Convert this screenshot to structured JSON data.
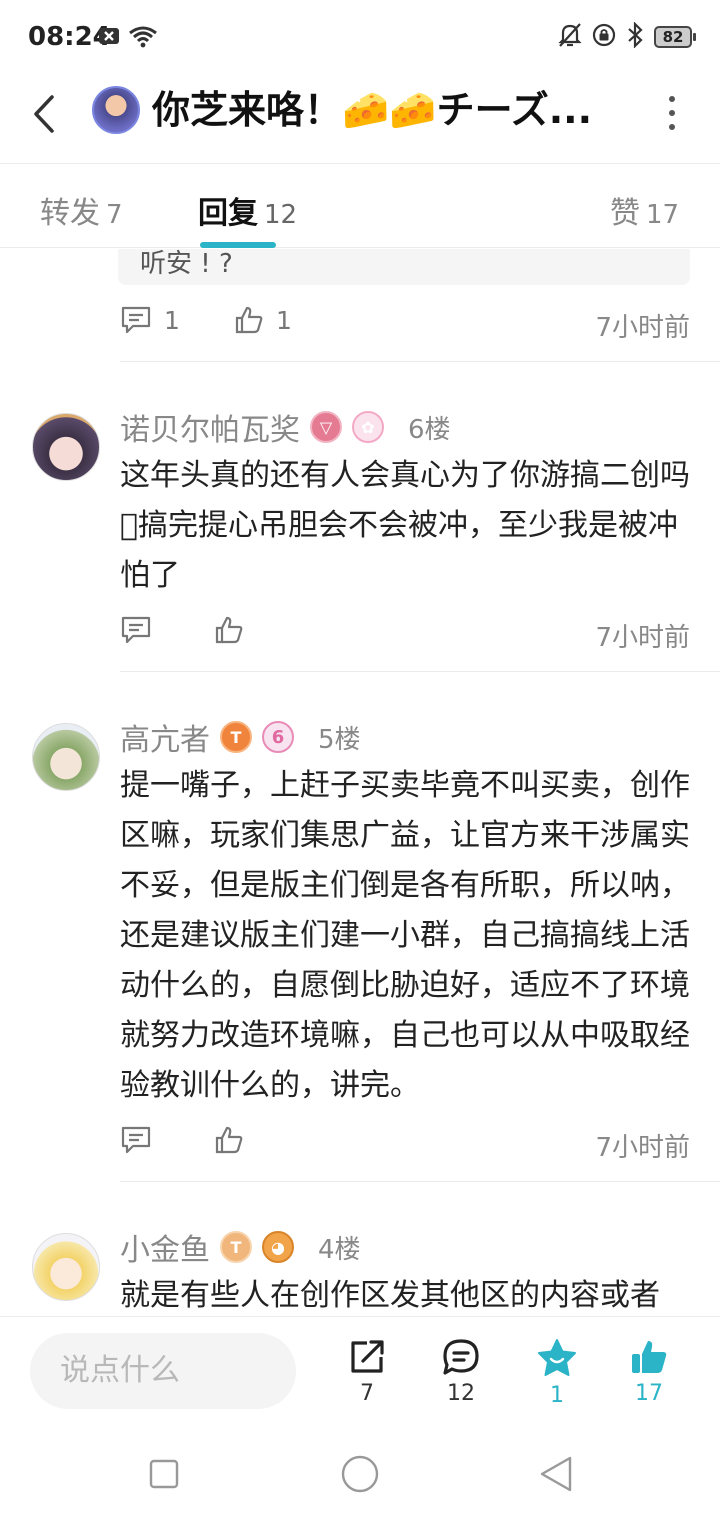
{
  "status_bar": {
    "time": "08:24",
    "battery": "82",
    "icons": [
      "close-box-icon",
      "wifi-icon",
      "mute-icon",
      "lock-icon",
      "bluetooth-icon",
      "battery-icon"
    ]
  },
  "header": {
    "title": "你芝来咯！🧀🧀チーズ...",
    "icons": [
      "back-icon",
      "more-icon"
    ]
  },
  "tabs": [
    {
      "label": "转发",
      "count": "7"
    },
    {
      "label": "回复",
      "count": "12",
      "active": true
    },
    {
      "label": "赞",
      "count": "17"
    }
  ],
  "prev_comment": {
    "quote_tail": "听安 ! ?",
    "reply_count": "1",
    "like_count": "1",
    "time": "7小时前"
  },
  "comments": [
    {
      "username": "诺贝尔帕瓦奖",
      "badges": [
        "pink-level-badge",
        "pink-character-badge"
      ],
      "floor": "6楼",
      "text": "这年头真的还有人会真心为了你游搞二创吗􏿾搞完提心吊胆会不会被冲，至少我是被冲怕了",
      "time": "7小时前"
    },
    {
      "username": "高亢者",
      "badges": [
        "orange-level-badge",
        "pink-cake-badge"
      ],
      "floor": "5楼",
      "text": "提一嘴子，上赶子买卖毕竟不叫买卖，创作区嘛，玩家们集思广益，让官方来干涉属实不妥，但是版主们倒是各有所职，所以呐，还是建议版主们建一小群，自己搞搞线上活动什么的，自愿倒比胁迫好，适应不了环境就努力改造环境嘛，自己也可以从中吸取经验教训什么的，讲完。",
      "time": "7小时前"
    },
    {
      "username": "小金鱼",
      "badges": [
        "peach-level-badge",
        "orange-cookie-badge"
      ],
      "floor": "4楼",
      "text": "就是有些人在创作区发其他区的内容或者",
      "time": ""
    }
  ],
  "bottom_bar": {
    "input_placeholder": "说点什么",
    "share_count": "7",
    "reply_count": "12",
    "fav_count": "1",
    "like_count": "17",
    "accent_color": "#2bb3c7"
  },
  "nav_bar": {
    "icons": [
      "recents-square-icon",
      "home-circle-icon",
      "back-triangle-icon"
    ]
  }
}
